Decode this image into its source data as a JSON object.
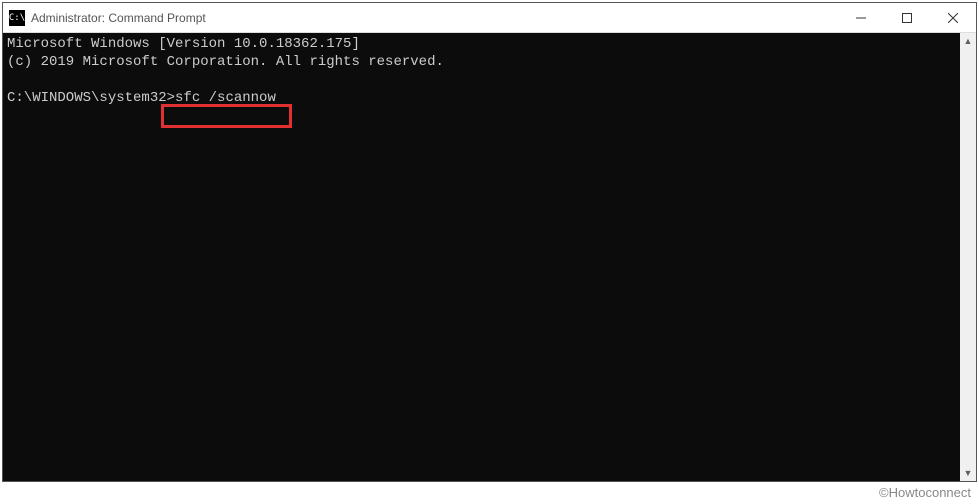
{
  "titlebar": {
    "icon_label": "C:\\",
    "title": "Administrator: Command Prompt"
  },
  "console": {
    "line1": "Microsoft Windows [Version 10.0.18362.175]",
    "line2": "(c) 2019 Microsoft Corporation. All rights reserved.",
    "prompt": "C:\\WINDOWS\\system32>",
    "command": "sfc /scannow"
  },
  "highlight": {
    "target": "sfc /scannow"
  },
  "watermark": "©Howtoconnect"
}
